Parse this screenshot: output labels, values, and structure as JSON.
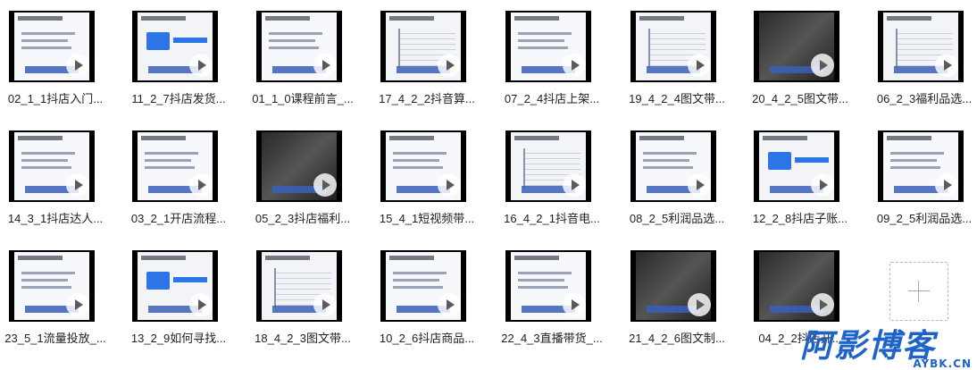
{
  "videos": [
    {
      "label": "02_1_1抖店入门...",
      "style": "light"
    },
    {
      "label": "11_2_7抖店发货...",
      "style": "box"
    },
    {
      "label": "01_1_0课程前言_...",
      "style": "light"
    },
    {
      "label": "17_4_2_2抖音算...",
      "style": "mind"
    },
    {
      "label": "07_2_4抖店上架...",
      "style": "light"
    },
    {
      "label": "19_4_2_4图文带...",
      "style": "mind"
    },
    {
      "label": "20_4_2_5图文带...",
      "style": "photo"
    },
    {
      "label": "06_2_3福利品选...",
      "style": "mind"
    },
    {
      "label": "14_3_1抖店达人...",
      "style": "light"
    },
    {
      "label": "03_2_1开店流程...",
      "style": "light"
    },
    {
      "label": "05_2_3抖店福利...",
      "style": "photo"
    },
    {
      "label": "15_4_1短视频带...",
      "style": "light"
    },
    {
      "label": "16_4_2_1抖音电...",
      "style": "mind"
    },
    {
      "label": "08_2_5利润品选...",
      "style": "light"
    },
    {
      "label": "12_2_8抖店子账...",
      "style": "box"
    },
    {
      "label": "09_2_5利润品选...",
      "style": "light"
    },
    {
      "label": "23_5_1流量投放_...",
      "style": "light"
    },
    {
      "label": "13_2_9如何寻找...",
      "style": "box"
    },
    {
      "label": "18_4_2_3图文带...",
      "style": "mind"
    },
    {
      "label": "10_2_6抖店商品...",
      "style": "light"
    },
    {
      "label": "22_4_3直播带货_...",
      "style": "light"
    },
    {
      "label": "21_4_2_6图文制...",
      "style": "photo"
    },
    {
      "label": "04_2_2抖店开...",
      "style": "photo"
    }
  ],
  "watermark": {
    "main": "阿影博客",
    "sub": "AYBK.CN"
  },
  "add_button": {
    "icon": "plus-icon"
  },
  "colors": {
    "accent": "#2d74e6",
    "watermark": "#1e63c7"
  }
}
